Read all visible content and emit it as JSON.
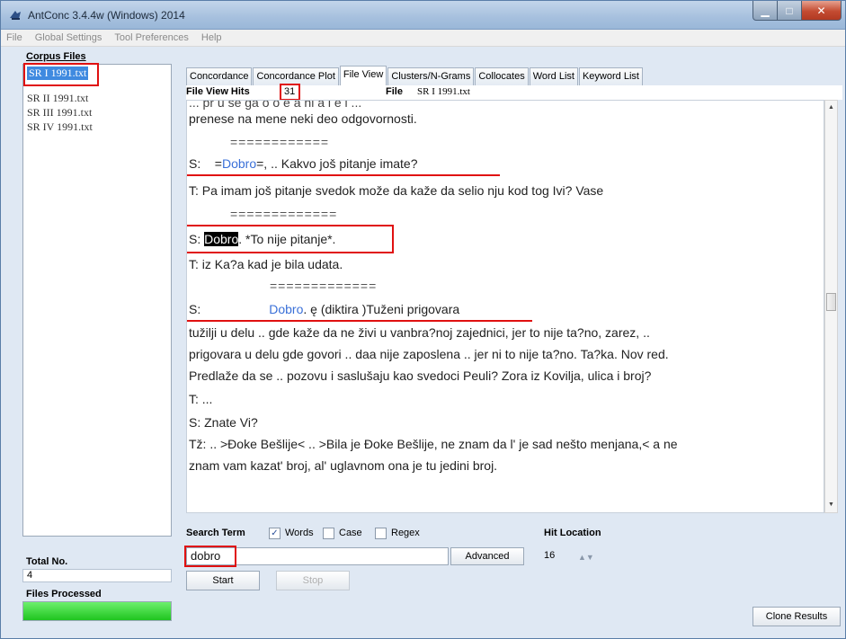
{
  "window": {
    "title": "AntConc 3.4.4w (Windows) 2014"
  },
  "menu": [
    "File",
    "Global Settings",
    "Tool Preferences",
    "Help"
  ],
  "sidebar": {
    "title": "Corpus Files",
    "files": [
      "SR I 1991.txt",
      "SR II 1991.txt",
      "SR III 1991.txt",
      "SR IV 1991.txt"
    ],
    "selected_index": 0,
    "total_label": "Total No.",
    "total_value": "4",
    "processed_label": "Files Processed",
    "processed_fraction": 1.0
  },
  "tabs": [
    "Concordance",
    "Concordance Plot",
    "File View",
    "Clusters/N-Grams",
    "Collocates",
    "Word List",
    "Keyword List"
  ],
  "active_tab": "File View",
  "hits": {
    "label": "File View Hits",
    "value": "31",
    "file_label": "File",
    "file_value": "SR I 1991.txt"
  },
  "text_lines": {
    "l0": "prenese na mene neki deo odgovornosti.",
    "sep1": "============",
    "l2_speaker": "S:",
    "l2_pre": "=",
    "l2_hit": "Dobro",
    "l2_post": "=, .. Kakvo još pitanje imate?",
    "l3": "T:  Pa imam još pitanje svedok može da kaže da selio nju kod tog Ivi? Vase",
    "sep2": "=============",
    "l5_speaker": "S:",
    "l5_hit": "Dobro",
    "l5_post": ". *To nije pitanje*.",
    "l6": "T:  iz Ka?a kad je bila udata.",
    "sep3": "=============",
    "l8_speaker": "S:",
    "l8_hit": "Dobro",
    "l8_post": ". ę (diktira )Tuženi prigovara",
    "l9": "    tužilji u delu .. gde kaže da ne živi u vanbra?noj zajednici, jer to nije ta?no, zarez, ..",
    "l10": "prigovara u delu gde govori .. daa nije zaposlena .. jer ni to nije ta?no. Ta?ka. Nov red.",
    "l11": "Predlaže da se .. pozovu i saslušaju kao svedoci Peuli? Zora iz Kovilja, ulica i broj?",
    "l12": "T:  ...",
    "l13": "S:  Znate Vi?",
    "l14": "Tž: .. >Đoke Bešlije< .. >Bila je Đoke Bešlije, ne znam da l' je sad nešto menjana,< a ne",
    "l15": "znam vam kazat' broj, al' uglavnom ona je tu jedini broj."
  },
  "search": {
    "term_label": "Search Term",
    "words_label": "Words",
    "words_checked": true,
    "case_label": "Case",
    "case_checked": false,
    "regex_label": "Regex",
    "regex_checked": false,
    "hit_location_label": "Hit Location",
    "hit_location_value": "16",
    "query": "dobro",
    "advanced_label": "Advanced",
    "start_label": "Start",
    "stop_label": "Stop",
    "clone_label": "Clone Results"
  },
  "colors": {
    "hit_highlight": "#3a70d8",
    "annotation_red": "#e01010",
    "selection": "#3f8ae0",
    "progress": "#1fc41f"
  }
}
